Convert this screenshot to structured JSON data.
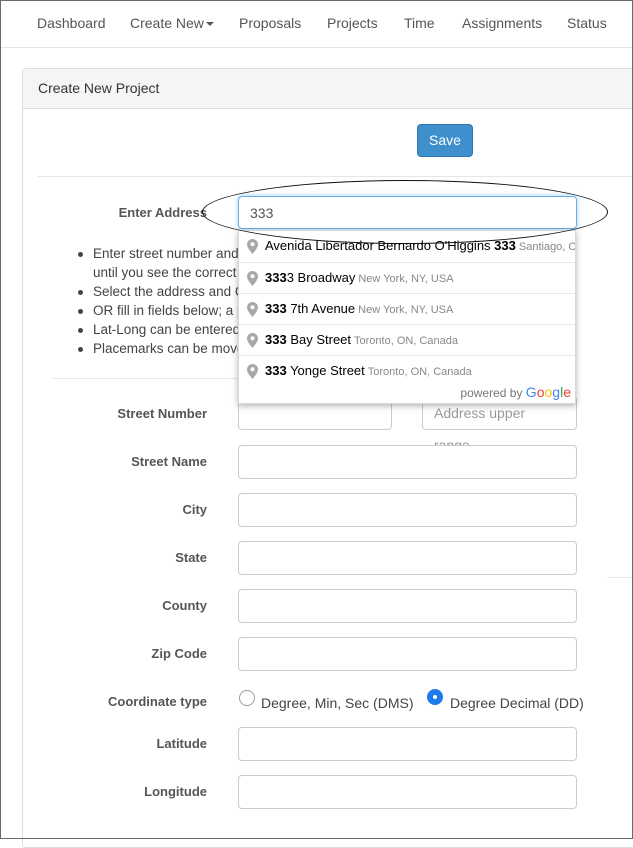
{
  "nav": {
    "items": [
      "Dashboard",
      "Create New",
      "Proposals",
      "Projects",
      "Time",
      "Assignments",
      "Status"
    ]
  },
  "panel": {
    "title": "Create New Project",
    "save_label": "Save"
  },
  "address": {
    "label": "Enter Address",
    "value": "333"
  },
  "help": [
    "Enter street number and p",
    "until you see the correct a",
    "Select the address and C",
    "OR fill in fields below; a p",
    "Lat-Long can be entered",
    "Placemarks can be move"
  ],
  "suggestions": [
    {
      "pre": "Avenida Libertador Bernardo O'Higgins ",
      "match": "333",
      "rest": "",
      "secondary": "Santiago, Chile"
    },
    {
      "pre": "",
      "match": "333",
      "rest": "3 Broadway",
      "secondary": "New York, NY, USA"
    },
    {
      "pre": "",
      "match": "333",
      "rest": " 7th Avenue",
      "secondary": "New York, NY, USA"
    },
    {
      "pre": "",
      "match": "333",
      "rest": " Bay Street",
      "secondary": "Toronto, ON, Canada"
    },
    {
      "pre": "",
      "match": "333",
      "rest": " Yonge Street",
      "secondary": "Toronto, ON, Canada"
    }
  ],
  "powered_by": {
    "text": "powered by",
    "brand": [
      "G",
      "o",
      "o",
      "g",
      "l",
      "e"
    ]
  },
  "fields": {
    "street_number": {
      "label": "Street Number",
      "upper_placeholder": "Address upper range.."
    },
    "street_name": {
      "label": "Street Name"
    },
    "city": {
      "label": "City"
    },
    "state": {
      "label": "State"
    },
    "county": {
      "label": "County"
    },
    "zip": {
      "label": "Zip Code"
    },
    "coordinate_type": {
      "label": "Coordinate type",
      "options": [
        "Degree, Min, Sec (DMS)",
        "Degree Decimal (DD)"
      ],
      "selected": "Degree Decimal (DD)"
    },
    "latitude": {
      "label": "Latitude"
    },
    "longitude": {
      "label": "Longitude"
    }
  },
  "colors": {
    "primary": "#3e8fcc",
    "radio_selected": "#1e7bea",
    "focus_border": "#66afe9"
  }
}
